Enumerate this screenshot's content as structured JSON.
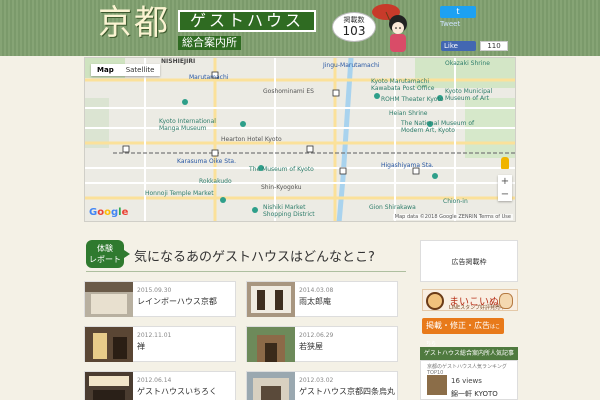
{
  "header": {
    "logo_main": "京都",
    "logo_sub_banner": "ゲストハウス",
    "logo_caption": "総合案内所",
    "count_label": "掲載数",
    "count_value": "103",
    "twitter_button": "t",
    "twitter_label": "Tweet",
    "fb_like_label": "Like",
    "fb_like_count": "110"
  },
  "map": {
    "type_buttons": [
      "Map",
      "Satellite"
    ],
    "labels": {
      "nishiyama": "NISHIEJIRI",
      "marutamachi": "Marutamachi",
      "kawabata": "Kyoto Marutamachi\nKawabata Post Office",
      "jingumaru": "Jingu-Marutamachi",
      "okazaki": "Okazaki Shrine",
      "rohm": "ROHM Theater Kyoto",
      "kyoto_museum": "Kyoto Municipal\nMuseum of Art",
      "kyoto_art": "The National Museum of\nModern Art, Kyoto",
      "heian": "Heian Shrine",
      "manga": "Kyoto International\nManga Museum",
      "hearton": "Hearton Hotel Kyoto",
      "karasuma": "Karasuma Oike Sta.",
      "museum_kyoto": "The Museum of Kyoto",
      "rokkaku": "Rokkakudo",
      "honnoji": "Honnoji Temple Market",
      "shinkyogoku": "Shin-Kyogoku",
      "nishiki": "Nishiki Market\nShopping District",
      "gion": "Gion Shirakawa",
      "higashiyama": "Higashiyama Sta.",
      "chionin": "Chion-in",
      "gosho": "Goshominami ES",
      "google": "Google",
      "credit": "Map data ©2018 Google  ZENRIN   Terms of Use",
      "zoom_in": "+",
      "zoom_out": "−"
    }
  },
  "report": {
    "badge": "体験\nレポート",
    "title": "気になるあのゲストハウスはどんなとこ?"
  },
  "cards": [
    {
      "date": "2015.09.30",
      "title": "レインボーハウス京都"
    },
    {
      "date": "2014.03.08",
      "title": "雨太郎庵"
    },
    {
      "date": "2012.11.01",
      "title": "禅"
    },
    {
      "date": "2012.06.29",
      "title": "若狭屋"
    },
    {
      "date": "2012.06.14",
      "title": "ゲストハウスいちろく"
    },
    {
      "date": "2012.03.02",
      "title": "ゲストハウス京都四条烏丸"
    }
  ],
  "sidebar": {
    "ad_heading": "広告掲載枠",
    "maikoinu_big": "まいこいぬ",
    "maikoinu_small": "LINEスタンプ好評発売中",
    "ad_button": "掲載・修正・広告",
    "ad_button_small": "はこちら",
    "ranking_head": "ゲストハウス総合案内所人気記事",
    "ranking_sub": "京都のゲストハウス人気ランキングTOP10",
    "ranking_views": "16 views",
    "ranking_name": "錦一軒 KYOTO"
  },
  "colors": {
    "header_green": "#7f9f6e",
    "dark_green": "#2f6b22",
    "orange": "#e87a1a"
  }
}
